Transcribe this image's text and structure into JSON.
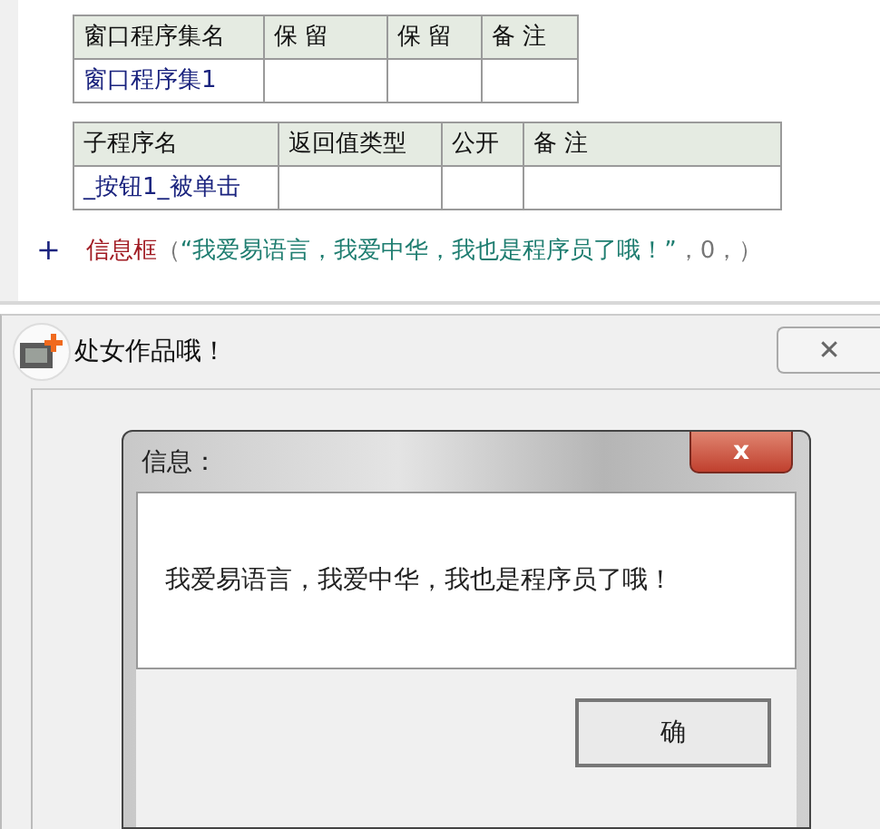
{
  "editor": {
    "tables": [
      {
        "columns": [
          "窗口程序集名",
          "保 留",
          "保 留",
          "备 注"
        ],
        "rows": [
          [
            "窗口程序集1",
            "",
            "",
            ""
          ]
        ]
      },
      {
        "columns": [
          "子程序名",
          "返回值类型",
          "公开",
          "备 注"
        ],
        "rows": [
          [
            "_按钮1_被单击",
            "",
            "",
            ""
          ]
        ]
      }
    ],
    "code_line": {
      "marker": "+",
      "parts": [
        {
          "kind": "command",
          "text": "信息框"
        },
        {
          "kind": "punct",
          "text": "（"
        },
        {
          "kind": "string",
          "text": "“我爱易语言，我爱中华，我也是程序员了哦！”"
        },
        {
          "kind": "punct",
          "text": "，0，）"
        }
      ]
    }
  },
  "window": {
    "title": "处女作品哦！",
    "close": "✕"
  },
  "message_box": {
    "title": "信息：",
    "close": "x",
    "message": "我爱易语言，我爱中华，我也是程序员了哦！",
    "button": "确"
  }
}
